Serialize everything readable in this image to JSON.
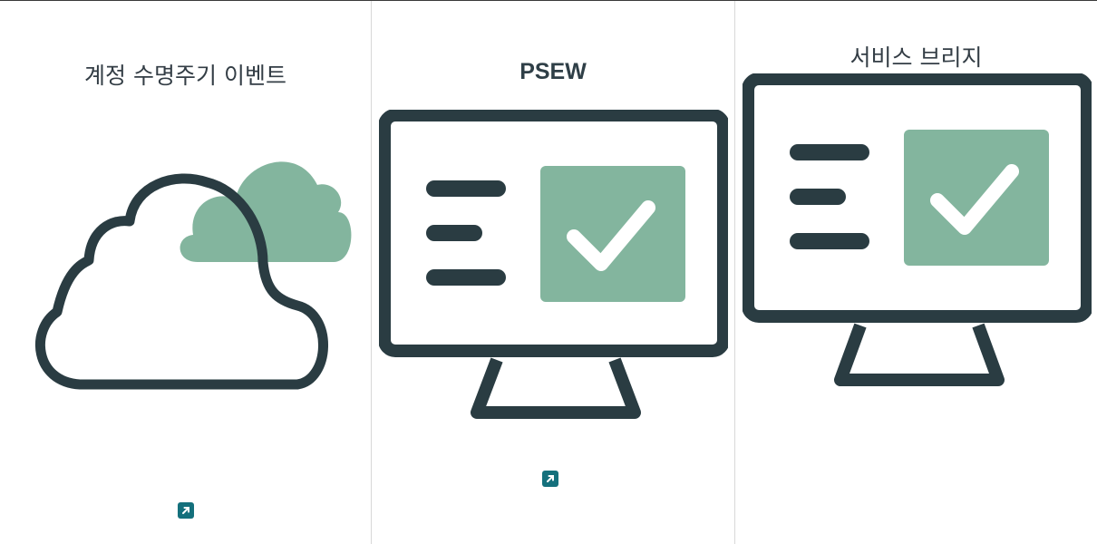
{
  "cards": [
    {
      "title": "계정 수명주기 이벤트",
      "illustration": "cloud-icon",
      "link_icon": "external-link-icon"
    },
    {
      "title": "PSEW",
      "illustration": "monitor-check-icon",
      "link_icon": "external-link-icon"
    },
    {
      "title": "서비스 브리지",
      "illustration": "monitor-check-icon"
    }
  ],
  "colors": {
    "dark": "#2a3c42",
    "accent_green": "#83b59e",
    "link": "#14707c",
    "divider": "#d8d8d8"
  }
}
